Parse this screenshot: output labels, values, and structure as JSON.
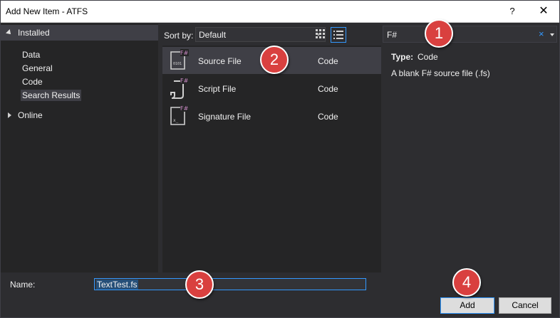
{
  "window": {
    "title": "Add New Item - ATFS",
    "help": "?",
    "close": "✕"
  },
  "sidebar": {
    "installed": "Installed",
    "items": [
      "Data",
      "General",
      "Code",
      "Search Results"
    ],
    "selected": "Search Results",
    "online": "Online"
  },
  "sortbar": {
    "label": "Sort by:",
    "value": "Default"
  },
  "items": [
    {
      "name": "Source File",
      "category": "Code",
      "icon": "fsharp-source-file-icon"
    },
    {
      "name": "Script File",
      "category": "Code",
      "icon": "fsharp-script-file-icon"
    },
    {
      "name": "Signature File",
      "category": "Code",
      "icon": "fsharp-signature-file-icon"
    }
  ],
  "search": {
    "value": "F#",
    "clear": "×"
  },
  "details": {
    "type_label": "Type:",
    "type_value": "Code",
    "description": "A blank F# source file (.fs)"
  },
  "bottom": {
    "name_label": "Name:",
    "name_value": "TextTest.fs",
    "add": "Add",
    "cancel": "Cancel"
  },
  "badges": [
    "1",
    "2",
    "3",
    "4"
  ],
  "colors": {
    "background": "#2d2d30",
    "panel": "#252526",
    "selection": "#3f3f46",
    "accent": "#3399ff",
    "badge": "#d9403f"
  }
}
